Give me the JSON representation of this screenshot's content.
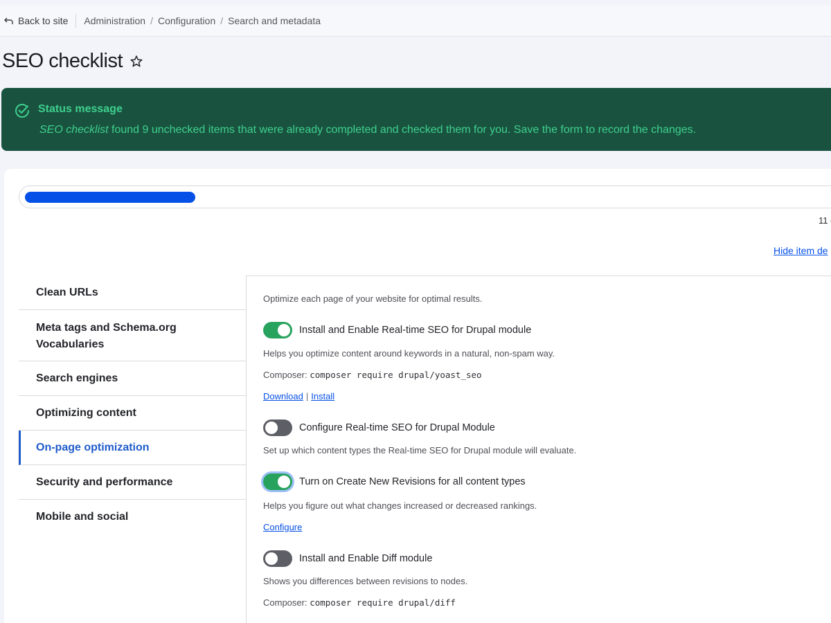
{
  "topbar": {
    "back_label": "Back to site",
    "breadcrumbs": [
      "Administration",
      "Configuration",
      "Search and metadata"
    ]
  },
  "page": {
    "title": "SEO checklist"
  },
  "status": {
    "heading": "Status message",
    "text_em": "SEO checklist",
    "text_rest": " found 9 unchecked items that were already completed and checked them for you. Save the form to record the changes."
  },
  "progress": {
    "fraction": 0.21,
    "count_text": "11 o"
  },
  "hide_link": "Hide item de",
  "tabs": [
    {
      "label": "Clean URLs",
      "active": false
    },
    {
      "label": "Meta tags and Schema.org Vocabularies",
      "active": false
    },
    {
      "label": "Search engines",
      "active": false
    },
    {
      "label": "Optimizing content",
      "active": false
    },
    {
      "label": "On-page optimization",
      "active": true
    },
    {
      "label": "Security and performance",
      "active": false
    },
    {
      "label": "Mobile and social",
      "active": false
    }
  ],
  "panel": {
    "intro": "Optimize each page of your website for optimal results.",
    "items": [
      {
        "label": "Install and Enable Real-time SEO for Drupal module",
        "checked": true,
        "description": "Helps you optimize content around keywords in a natural, non-spam way.",
        "composer_label": "Composer: ",
        "composer_cmd": "composer require drupal/yoast_seo",
        "links": [
          "Download",
          "Install"
        ]
      },
      {
        "label": "Configure Real-time SEO for Drupal Module",
        "checked": false,
        "description": "Set up which content types the Real-time SEO for Drupal module will evaluate."
      },
      {
        "label": "Turn on Create New Revisions for all content types",
        "checked": true,
        "description": "Helps you figure out what changes increased or decreased rankings.",
        "links": [
          "Configure"
        ]
      },
      {
        "label": "Install and Enable Diff module",
        "checked": false,
        "description": "Shows you differences between revisions to nodes.",
        "composer_label": "Composer: ",
        "composer_cmd": "composer require drupal/diff"
      }
    ]
  },
  "colors": {
    "accent": "#0550e6",
    "status_bg": "#19533f",
    "status_text": "#3fcf8e",
    "toggle_on": "#28a35d",
    "toggle_off": "#5e5f66"
  }
}
